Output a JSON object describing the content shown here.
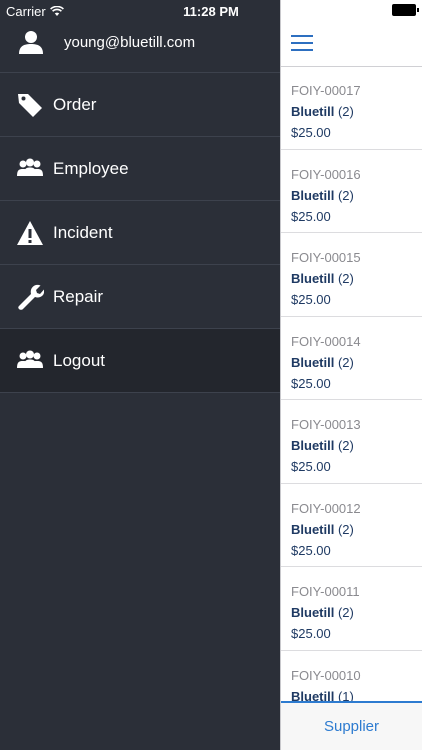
{
  "status_bar": {
    "carrier": "Carrier",
    "time": "11:28 PM"
  },
  "menu": {
    "user_email": "young@bluetill.com",
    "items": [
      {
        "label": "Order",
        "icon": "tag-icon"
      },
      {
        "label": "Employee",
        "icon": "group-icon"
      },
      {
        "label": "Incident",
        "icon": "warning-icon"
      },
      {
        "label": "Repair",
        "icon": "wrench-icon"
      },
      {
        "label": "Logout",
        "icon": "group-icon"
      }
    ]
  },
  "orders": [
    {
      "code": "FOIY-00017",
      "supplier": "Bluetill",
      "count": "(2)",
      "price": "$25.00"
    },
    {
      "code": "FOIY-00016",
      "supplier": "Bluetill",
      "count": "(2)",
      "price": "$25.00"
    },
    {
      "code": "FOIY-00015",
      "supplier": "Bluetill",
      "count": "(2)",
      "price": "$25.00"
    },
    {
      "code": "FOIY-00014",
      "supplier": "Bluetill",
      "count": "(2)",
      "price": "$25.00"
    },
    {
      "code": "FOIY-00013",
      "supplier": "Bluetill",
      "count": "(2)",
      "price": "$25.00"
    },
    {
      "code": "FOIY-00012",
      "supplier": "Bluetill",
      "count": "(2)",
      "price": "$25.00"
    },
    {
      "code": "FOIY-00011",
      "supplier": "Bluetill",
      "count": "(2)",
      "price": "$25.00"
    },
    {
      "code": "FOIY-00010",
      "supplier": "Bluetill",
      "count": "(1)",
      "price": ""
    }
  ],
  "tabbar": {
    "label": "Supplier"
  },
  "colors": {
    "menu_bg": "#2b2f38",
    "accent": "#2d7bd0",
    "order_text": "#1f3a63"
  }
}
